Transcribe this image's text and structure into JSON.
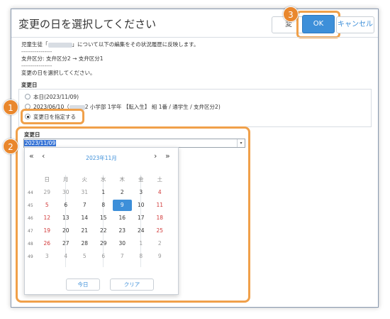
{
  "dialog": {
    "title": "変更の日を選択してください",
    "ok_label": "OK",
    "cancel_label": "キャンセル",
    "hidden_button_label": "変"
  },
  "info": {
    "line1_prefix": "児童生徒「",
    "line1_suffix": "」について以下の編集をその状況履歴に反映します。",
    "sep1": "----------------",
    "line2": "支弁区分: 支弁区分2 → 支弁区分1",
    "sep2": "----------------",
    "line3": "変更の日を選択してください。"
  },
  "change_date_label": "変更日",
  "options": [
    {
      "label": "本日(2023/11/09)",
      "checked": false
    },
    {
      "label_prefix": "2023/06/10（",
      "label_suffix": "2 小学部 1学年 【転入生】 組 1番 / 通学生 / 支弁区分2)",
      "checked": false
    },
    {
      "label": "変更日を指定する",
      "checked": true
    }
  ],
  "date_field": {
    "label": "変更日",
    "value": "2023/11/09"
  },
  "calendar": {
    "month_label": "2023年11月",
    "prev_year": "«",
    "prev_month": "‹",
    "next_month": "›",
    "next_year": "»",
    "weekdays": [
      "日",
      "月",
      "火",
      "水",
      "木",
      "金",
      "土"
    ],
    "weeks": [
      {
        "no": "44",
        "days": [
          "29",
          "30",
          "31",
          "1",
          "2",
          "3",
          "4"
        ]
      },
      {
        "no": "45",
        "days": [
          "5",
          "6",
          "7",
          "8",
          "9",
          "10",
          "11"
        ]
      },
      {
        "no": "46",
        "days": [
          "12",
          "13",
          "14",
          "15",
          "16",
          "17",
          "18"
        ]
      },
      {
        "no": "47",
        "days": [
          "19",
          "20",
          "21",
          "22",
          "23",
          "24",
          "25"
        ]
      },
      {
        "no": "48",
        "days": [
          "26",
          "27",
          "28",
          "29",
          "30",
          "1",
          "2"
        ]
      },
      {
        "no": "49",
        "days": [
          "3",
          "4",
          "5",
          "6",
          "7",
          "8",
          "9"
        ]
      }
    ],
    "today_button": "今日",
    "clear_button": "クリア"
  },
  "callouts": [
    "1",
    "2",
    "3"
  ],
  "colors": {
    "accent": "#3d8fd9",
    "highlight_outline": "#f0a04a",
    "badge": "#e9872d",
    "sunday": "#d13838",
    "saturday": "#d13838"
  }
}
